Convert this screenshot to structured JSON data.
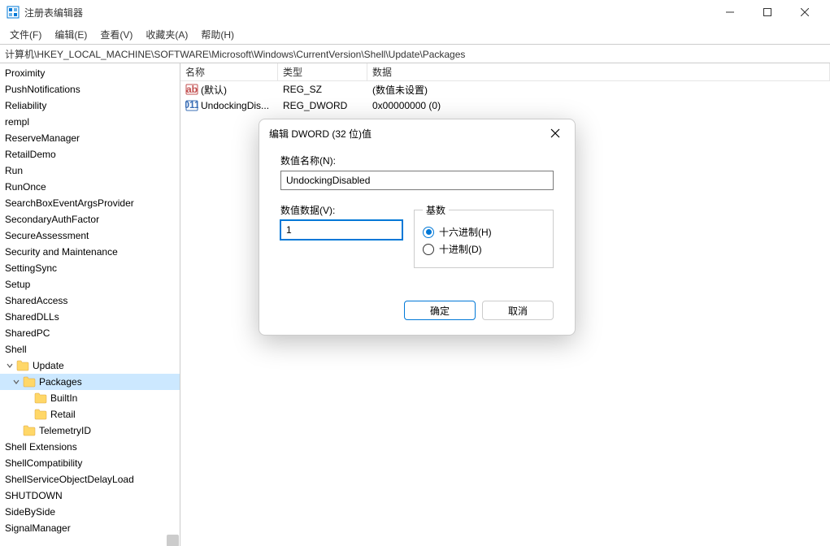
{
  "window": {
    "title": "注册表编辑器"
  },
  "menu": {
    "file": "文件(F)",
    "edit": "编辑(E)",
    "view": "查看(V)",
    "favorites": "收藏夹(A)",
    "help": "帮助(H)"
  },
  "address": "计算机\\HKEY_LOCAL_MACHINE\\SOFTWARE\\Microsoft\\Windows\\CurrentVersion\\Shell\\Update\\Packages",
  "tree": {
    "items": [
      {
        "label": "Proximity",
        "indent": 0
      },
      {
        "label": "PushNotifications",
        "indent": 0
      },
      {
        "label": "Reliability",
        "indent": 0
      },
      {
        "label": "rempl",
        "indent": 0
      },
      {
        "label": "ReserveManager",
        "indent": 0
      },
      {
        "label": "RetailDemo",
        "indent": 0
      },
      {
        "label": "Run",
        "indent": 0
      },
      {
        "label": "RunOnce",
        "indent": 0
      },
      {
        "label": "SearchBoxEventArgsProvider",
        "indent": 0
      },
      {
        "label": "SecondaryAuthFactor",
        "indent": 0
      },
      {
        "label": "SecureAssessment",
        "indent": 0
      },
      {
        "label": "Security and Maintenance",
        "indent": 0
      },
      {
        "label": "SettingSync",
        "indent": 0
      },
      {
        "label": "Setup",
        "indent": 0
      },
      {
        "label": "SharedAccess",
        "indent": 0
      },
      {
        "label": "SharedDLLs",
        "indent": 0
      },
      {
        "label": "SharedPC",
        "indent": 0
      },
      {
        "label": "Shell",
        "indent": 0
      },
      {
        "label": "Update",
        "indent": 1,
        "hasFolder": true,
        "expanded": true
      },
      {
        "label": "Packages",
        "indent": 2,
        "hasFolder": true,
        "expanded": true,
        "selected": true
      },
      {
        "label": "BuiltIn",
        "indent": 3,
        "hasFolder": true
      },
      {
        "label": "Retail",
        "indent": 3,
        "hasFolder": true
      },
      {
        "label": "TelemetryID",
        "indent": 2,
        "hasFolder": true
      },
      {
        "label": "Shell Extensions",
        "indent": 0
      },
      {
        "label": "ShellCompatibility",
        "indent": 0
      },
      {
        "label": "ShellServiceObjectDelayLoad",
        "indent": 0
      },
      {
        "label": "SHUTDOWN",
        "indent": 0
      },
      {
        "label": "SideBySide",
        "indent": 0
      },
      {
        "label": "SignalManager",
        "indent": 0
      }
    ]
  },
  "list": {
    "headers": {
      "name": "名称",
      "type": "类型",
      "data": "数据"
    },
    "rows": [
      {
        "name": "(默认)",
        "type": "REG_SZ",
        "data": "(数值未设置)",
        "icon": "string"
      },
      {
        "name": "UndockingDis...",
        "type": "REG_DWORD",
        "data": "0x00000000 (0)",
        "icon": "binary"
      }
    ]
  },
  "dialog": {
    "title": "编辑 DWORD (32 位)值",
    "name_label": "数值名称(N):",
    "name_value": "UndockingDisabled",
    "data_label": "数值数据(V):",
    "data_value": "1",
    "base_label": "基数",
    "hex_label": "十六进制(H)",
    "dec_label": "十进制(D)",
    "ok": "确定",
    "cancel": "取消"
  }
}
